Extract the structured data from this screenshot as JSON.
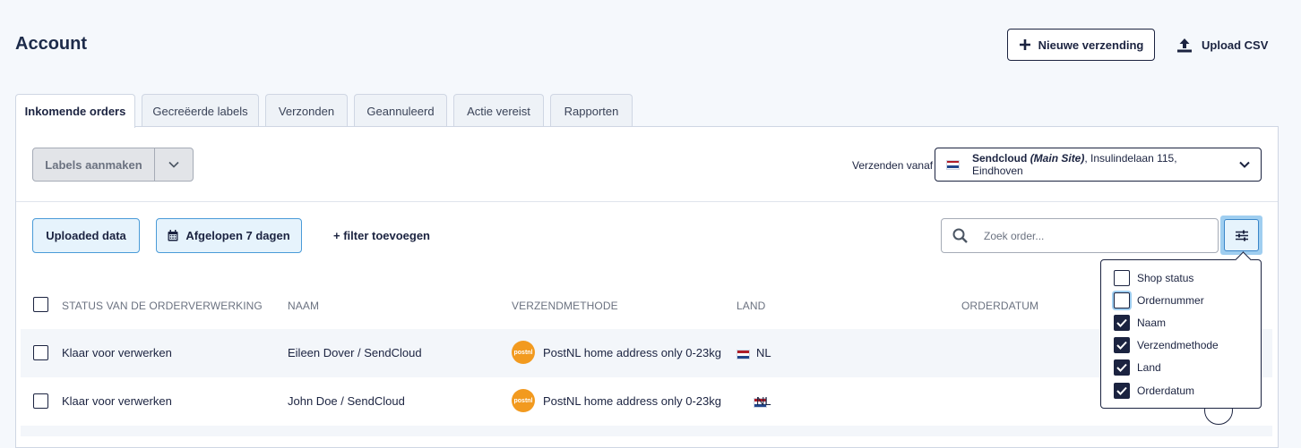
{
  "page": {
    "title": "Account"
  },
  "header": {
    "new_shipment_label": "Nieuwe verzending",
    "upload_csv_label": "Upload CSV"
  },
  "tabs": [
    {
      "label": "Inkomende orders"
    },
    {
      "label": "Gecreëerde labels"
    },
    {
      "label": "Verzonden"
    },
    {
      "label": "Geannuleerd"
    },
    {
      "label": "Actie vereist"
    },
    {
      "label": "Rapporten"
    }
  ],
  "toolbar": {
    "create_labels_label": "Labels aanmaken",
    "ship_from_label": "Verzenden vanaf",
    "ship_from": {
      "name": "Sendcloud",
      "site": "(Main Site)",
      "address": ", Insulindelaan 115, Eindhoven"
    }
  },
  "filters": {
    "uploaded_data_label": "Uploaded data",
    "date_range_label": "Afgelopen 7 dagen",
    "add_filter_label": "+ filter toevoegen",
    "search_placeholder": "Zoek order..."
  },
  "table": {
    "headers": [
      "STATUS VAN DE ORDERVERWERKING",
      "NAAM",
      "VERZENDMETHODE",
      "LAND",
      "ORDERDATUM"
    ],
    "rows": [
      {
        "status": "Klaar voor verwerken",
        "name": "Eileen Dover / SendCloud",
        "method": "PostNL home address only 0-23kg",
        "carrier_logo_text": "postnl",
        "country": "NL"
      },
      {
        "status": "Klaar voor verwerken",
        "name": "John Doe / SendCloud",
        "method": "PostNL home address only 0-23kg",
        "carrier_logo_text": "postnl",
        "country": "NL"
      }
    ]
  },
  "column_menu": {
    "options": [
      {
        "label": "Shop status",
        "checked": false
      },
      {
        "label": "Ordernummer",
        "checked": false
      },
      {
        "label": "Naam",
        "checked": true
      },
      {
        "label": "Verzendmethode",
        "checked": true
      },
      {
        "label": "Land",
        "checked": true
      },
      {
        "label": "Orderdatum",
        "checked": true
      }
    ]
  },
  "colors": {
    "navy": "#1b2340",
    "chip_bg": "#e6f3fc",
    "chip_border": "#4a9bd8",
    "postnl_orange": "#f29a1f",
    "nl_red": "#ae1c28",
    "nl_blue": "#21468b"
  },
  "icons": [
    "plus-icon",
    "upload-icon",
    "chevron-down-icon",
    "calendar-icon",
    "search-icon",
    "sliders-icon",
    "check-icon",
    "nl-flag-icon",
    "postnl-logo"
  ]
}
